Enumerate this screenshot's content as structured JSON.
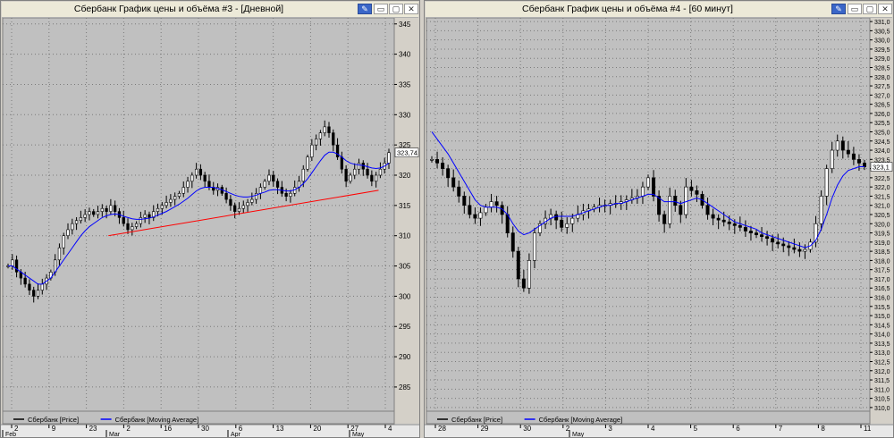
{
  "windows": [
    {
      "title": "Сбербанк График цены и объёма #3 - [Дневной]",
      "last_price_label": "323,74",
      "legend": [
        {
          "label": "Сбербанк [Price]",
          "color": "#000000"
        },
        {
          "label": "Сбербанк [Moving Average]",
          "color": "#0000ff"
        }
      ],
      "x_tick_labels": [
        "2",
        "9",
        "23",
        "2",
        "16",
        "30",
        "6",
        "13",
        "20",
        "27",
        "4"
      ],
      "x_month_labels": [
        "Feb",
        "Mar",
        "Apr",
        "May"
      ]
    },
    {
      "title": "Сбербанк График цены и объёма #4 - [60 минут]",
      "last_price_label": "323,1",
      "legend": [
        {
          "label": "Сбербанк [Price]",
          "color": "#000000"
        },
        {
          "label": "Сбербанк [Moving Average]",
          "color": "#0000ff"
        }
      ],
      "x_tick_labels": [
        "28",
        "29",
        "30",
        "2",
        "3",
        "4",
        "5",
        "6",
        "7",
        "8",
        "11"
      ],
      "x_month_labels": [
        "May"
      ]
    }
  ],
  "chart_data": [
    {
      "type": "candlestick",
      "title": "Сбербанк График цены и объёма #3 - [Дневной]",
      "ylim": [
        281,
        346
      ],
      "y_ticks": [
        285,
        290,
        295,
        300,
        305,
        310,
        315,
        320,
        325,
        330,
        335,
        340,
        345
      ],
      "grid": true,
      "legend_position": "bottom",
      "series": [
        {
          "name": "Сбербанк [Price]"
        },
        {
          "name": "Сбербанк [Moving Average]"
        }
      ],
      "close": [
        305,
        306,
        304,
        303,
        302,
        301,
        300,
        301,
        302,
        303,
        304,
        306,
        308,
        310,
        311,
        312,
        312.5,
        313,
        313.5,
        314,
        313.5,
        314,
        314.5,
        314,
        315,
        314,
        313,
        312,
        311,
        311.5,
        312,
        313,
        313.5,
        313,
        314,
        314.5,
        315,
        315.5,
        316,
        316.5,
        317,
        318,
        319,
        320,
        321,
        320,
        319,
        318,
        317.5,
        318,
        317,
        316,
        315,
        314,
        314.5,
        315,
        315.5,
        316,
        317,
        318,
        319,
        320,
        319,
        318,
        317,
        316.5,
        317,
        318,
        319,
        321,
        323,
        325,
        326,
        327,
        328,
        327,
        325,
        323,
        321,
        319,
        320,
        321,
        322,
        321,
        320,
        319,
        320,
        321,
        322,
        323.74
      ],
      "moving_average": [
        305,
        305,
        304.5,
        304,
        303.5,
        303,
        302.5,
        302,
        302,
        302.5,
        303,
        304,
        305,
        306,
        307,
        308,
        309,
        310,
        310.8,
        311.5,
        312,
        312.5,
        313,
        313.3,
        313.5,
        313.6,
        313.5,
        313.2,
        313,
        312.8,
        312.7,
        312.7,
        312.8,
        312.9,
        313.1,
        313.4,
        313.7,
        314,
        314.4,
        314.8,
        315.2,
        315.7,
        316.2,
        316.8,
        317.4,
        317.8,
        318,
        318,
        318,
        317.8,
        317.6,
        317.3,
        317,
        316.7,
        316.5,
        316.4,
        316.4,
        316.5,
        316.7,
        317,
        317.2,
        317.5,
        317.6,
        317.6,
        317.5,
        317.4,
        317.4,
        317.6,
        318,
        318.6,
        319.4,
        320.4,
        321.4,
        322.4,
        323.3,
        323.8,
        323.8,
        323.5,
        323,
        322.4,
        322,
        321.8,
        321.7,
        321.6,
        321.4,
        321.2,
        321.1,
        321.2,
        321.5,
        322
      ],
      "trendline": {
        "from": [
          0.27,
          310
        ],
        "to": [
          0.96,
          317.5
        ]
      }
    },
    {
      "type": "candlestick",
      "title": "Сбербанк График цены и объёма #4 - [60 минут]",
      "ylim": [
        309.8,
        331.2
      ],
      "y_ticks": [
        310,
        310.5,
        311,
        311.5,
        312,
        312.5,
        313,
        313.5,
        314,
        314.5,
        315,
        315.5,
        316,
        316.5,
        317,
        317.5,
        318,
        318.5,
        319,
        319.5,
        320,
        320.5,
        321,
        321.5,
        322,
        322.5,
        323,
        323.5,
        324,
        324.5,
        325,
        325.5,
        326,
        326.5,
        327,
        327.5,
        328,
        328.5,
        329,
        329.5,
        330,
        330.5,
        331
      ],
      "grid": true,
      "legend_position": "bottom",
      "series": [
        {
          "name": "Сбербанк [Price]"
        },
        {
          "name": "Сбербанк [Moving Average]"
        }
      ],
      "close": [
        323.5,
        323.3,
        323,
        322.5,
        322,
        321.5,
        321,
        320.5,
        320.3,
        320.6,
        320.9,
        321.2,
        321,
        320.5,
        319.5,
        318.5,
        317,
        316.5,
        318,
        319.5,
        320,
        320.3,
        320.5,
        320.2,
        319.8,
        320,
        320.3,
        320.5,
        320.7,
        320.8,
        320.9,
        321,
        321,
        321.1,
        321.1,
        321.2,
        321.3,
        321.4,
        321.5,
        322,
        322.5,
        321.5,
        320.5,
        320,
        321.5,
        321,
        320.5,
        322,
        321.8,
        321.6,
        321,
        320.5,
        320.3,
        320.2,
        320.1,
        320,
        319.9,
        319.8,
        319.6,
        319.5,
        319.4,
        319.3,
        319.2,
        319,
        318.9,
        318.8,
        318.7,
        318.6,
        318.5,
        318.6,
        319,
        320,
        321.5,
        323,
        324,
        324.5,
        324,
        323.8,
        323.5,
        323.3,
        323.1
      ],
      "moving_average": [
        325,
        324.6,
        324.2,
        323.8,
        323.3,
        322.8,
        322.3,
        321.8,
        321.3,
        321,
        320.9,
        320.9,
        320.9,
        320.8,
        320.5,
        320,
        319.6,
        319.4,
        319.5,
        319.7,
        319.9,
        320.1,
        320.3,
        320.4,
        320.4,
        320.4,
        320.4,
        320.5,
        320.6,
        320.7,
        320.8,
        320.9,
        321,
        321,
        321.1,
        321.1,
        321.2,
        321.3,
        321.4,
        321.5,
        321.6,
        321.6,
        321.4,
        321.2,
        321.2,
        321.2,
        321.1,
        321.2,
        321.3,
        321.4,
        321.3,
        321.1,
        320.9,
        320.7,
        320.5,
        320.3,
        320.1,
        320,
        319.9,
        319.8,
        319.7,
        319.5,
        319.4,
        319.3,
        319.2,
        319.1,
        319,
        318.9,
        318.8,
        318.7,
        318.8,
        319.1,
        319.7,
        320.5,
        321.4,
        322.1,
        322.6,
        322.9,
        323,
        323.1,
        323.1
      ]
    }
  ]
}
